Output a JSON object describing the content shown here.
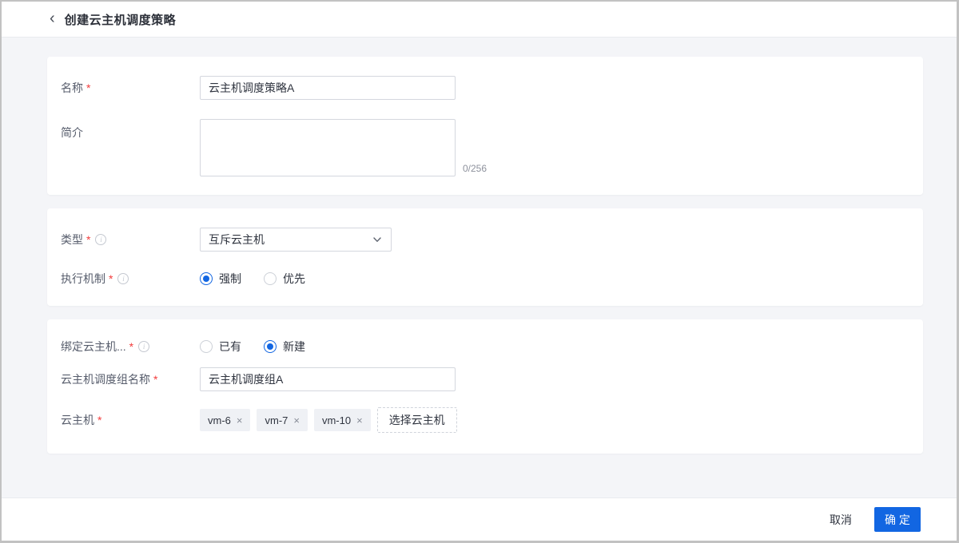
{
  "icons": {
    "back": "‹",
    "info": "i",
    "close": "×"
  },
  "colors": {
    "primary": "#1266e2",
    "required": "#f23c3c",
    "content_bg": "#f4f5f8"
  },
  "header": {
    "title": "创建云主机调度策略"
  },
  "card1": {
    "name": {
      "label": "名称",
      "required": "*",
      "value": "云主机调度策略A"
    },
    "intro": {
      "label": "简介",
      "value": "",
      "counter": "0/256"
    }
  },
  "card2": {
    "type": {
      "label": "类型",
      "required": "*",
      "value": "互斥云主机"
    },
    "mechanism": {
      "label": "执行机制",
      "required": "*",
      "options": [
        {
          "label": "强制",
          "selected": true
        },
        {
          "label": "优先",
          "selected": false
        }
      ]
    }
  },
  "card3": {
    "bind_group": {
      "label": "绑定云主机...",
      "required": "*",
      "options": [
        {
          "label": "已有",
          "selected": false
        },
        {
          "label": "新建",
          "selected": true
        }
      ]
    },
    "group_name": {
      "label": "云主机调度组名称",
      "required": "*",
      "value": "云主机调度组A"
    },
    "hosts": {
      "label": "云主机",
      "required": "*",
      "tags": [
        "vm-6",
        "vm-7",
        "vm-10"
      ],
      "select_button": "选择云主机"
    }
  },
  "footer": {
    "cancel": "取消",
    "confirm": "确 定"
  }
}
